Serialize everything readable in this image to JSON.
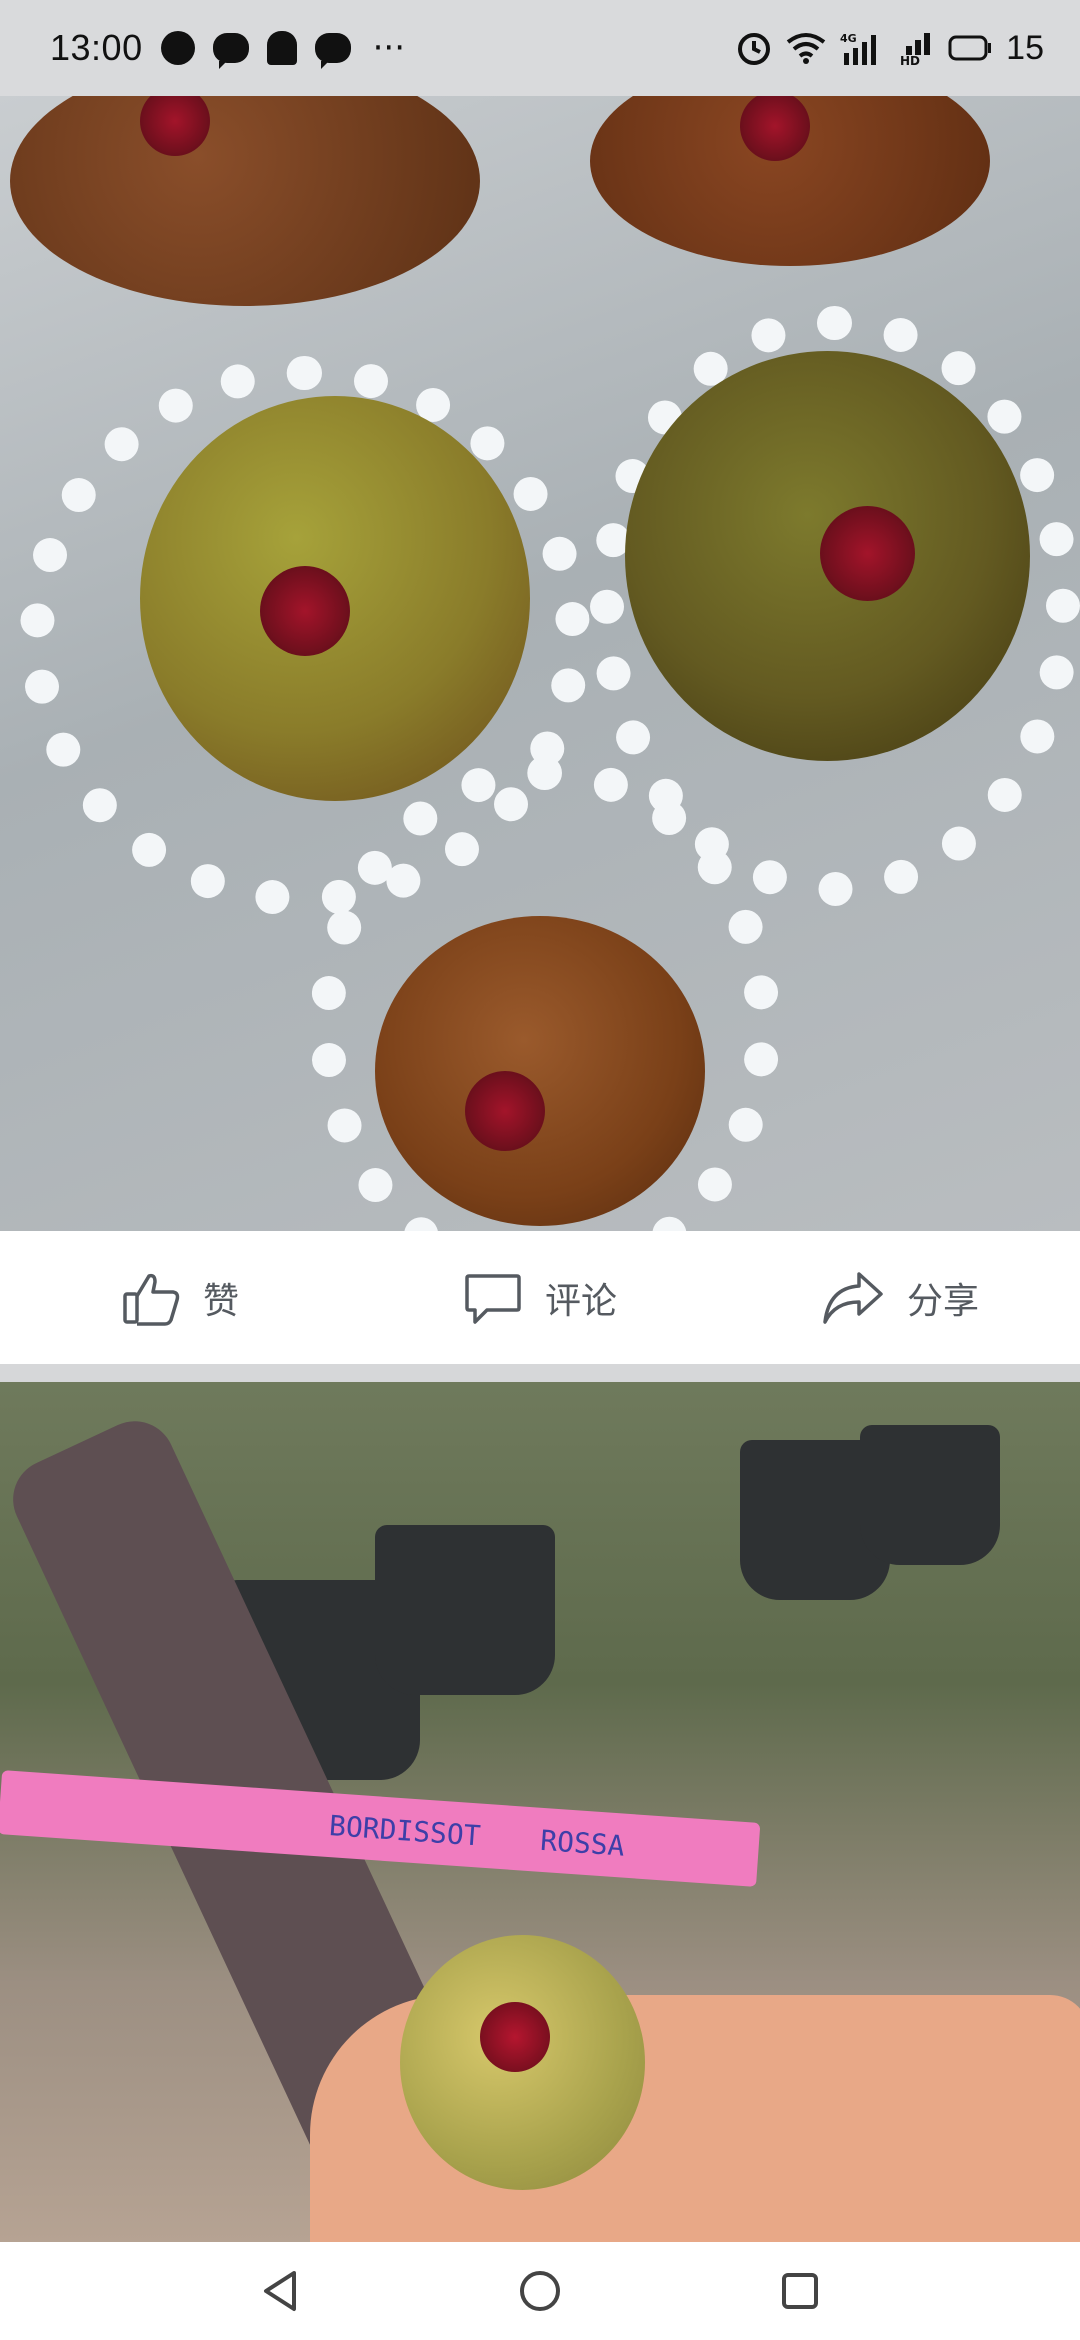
{
  "status_bar": {
    "time": "13:00",
    "notification_icons": [
      "chat-icon",
      "message-icon",
      "ghost-icon",
      "message-icon"
    ],
    "more_indicator": "···",
    "signal_label": "4G",
    "hd_label": "HD",
    "battery_level": "15"
  },
  "post_actions": {
    "like_label": "赞",
    "comment_label": "评论",
    "share_label": "分享"
  },
  "photo2": {
    "tag_text_1": "BORDISSOT",
    "tag_text_2": "ROSSA"
  }
}
